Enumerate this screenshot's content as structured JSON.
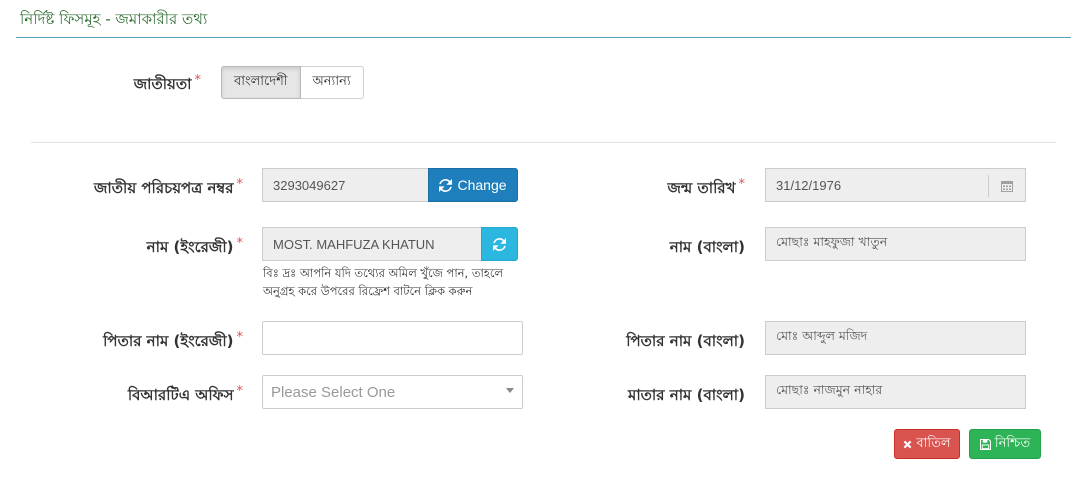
{
  "page": {
    "title": "নির্দিষ্ট ফিসমূহ - জমাকারীর তথ্য"
  },
  "nationality": {
    "label": "জাতীয়তা",
    "required_mark": "*",
    "options": [
      "বাংলাদেশী",
      "অন্যান্য"
    ],
    "selected": "বাংলাদেশী"
  },
  "nid": {
    "label": "জাতীয় পরিচয়পত্র নম্বর",
    "required_mark": "*",
    "value": "3293049627",
    "change_label": "Change"
  },
  "dob": {
    "label": "জন্ম তারিখ",
    "required_mark": "*",
    "value": "31/12/1976"
  },
  "name_en": {
    "label": "নাম (ইংরেজী)",
    "required_mark": "*",
    "value": "MOST. MAHFUZA KHATUN"
  },
  "name_bn": {
    "label": "নাম (বাংলা)",
    "value": "মোছাঃ মাহফুজা খাতুন"
  },
  "hint": {
    "line1": "বিঃ দ্রঃ আপনি যদি তথ্যের অমিল খুঁজে পান, তাহলে",
    "line2": "অনুগ্রহ করে উপরের রিফ্রেশ বাটনে ক্লিক করুন"
  },
  "father_en": {
    "label": "পিতার নাম (ইংরেজী)",
    "required_mark": "*",
    "value": ""
  },
  "father_bn": {
    "label": "পিতার নাম (বাংলা)",
    "value": "মোঃ আব্দুল মজিদ"
  },
  "brta_office": {
    "label": "বিআরটিএ অফিস",
    "required_mark": "*",
    "placeholder": "Please Select One"
  },
  "mother_bn": {
    "label": "মাতার নাম (বাংলা)",
    "value": "মোছাঃ নাজমুন নাহার"
  },
  "actions": {
    "cancel_label": "বাতিল",
    "confirm_label": "নিশ্চিত"
  },
  "colors": {
    "title_green": "#2c6b2f",
    "required_red": "#d9534f",
    "change_blue": "#1f7fbd",
    "refresh_cyan": "#2bb7e0",
    "cancel_red": "#d9534f",
    "confirm_green": "#2db457"
  },
  "icons": {
    "change": "refresh-icon",
    "refresh": "refresh-icon",
    "date": "calendar-icon",
    "cancel": "close-icon",
    "confirm": "save-icon",
    "select": "caret-down-icon"
  }
}
